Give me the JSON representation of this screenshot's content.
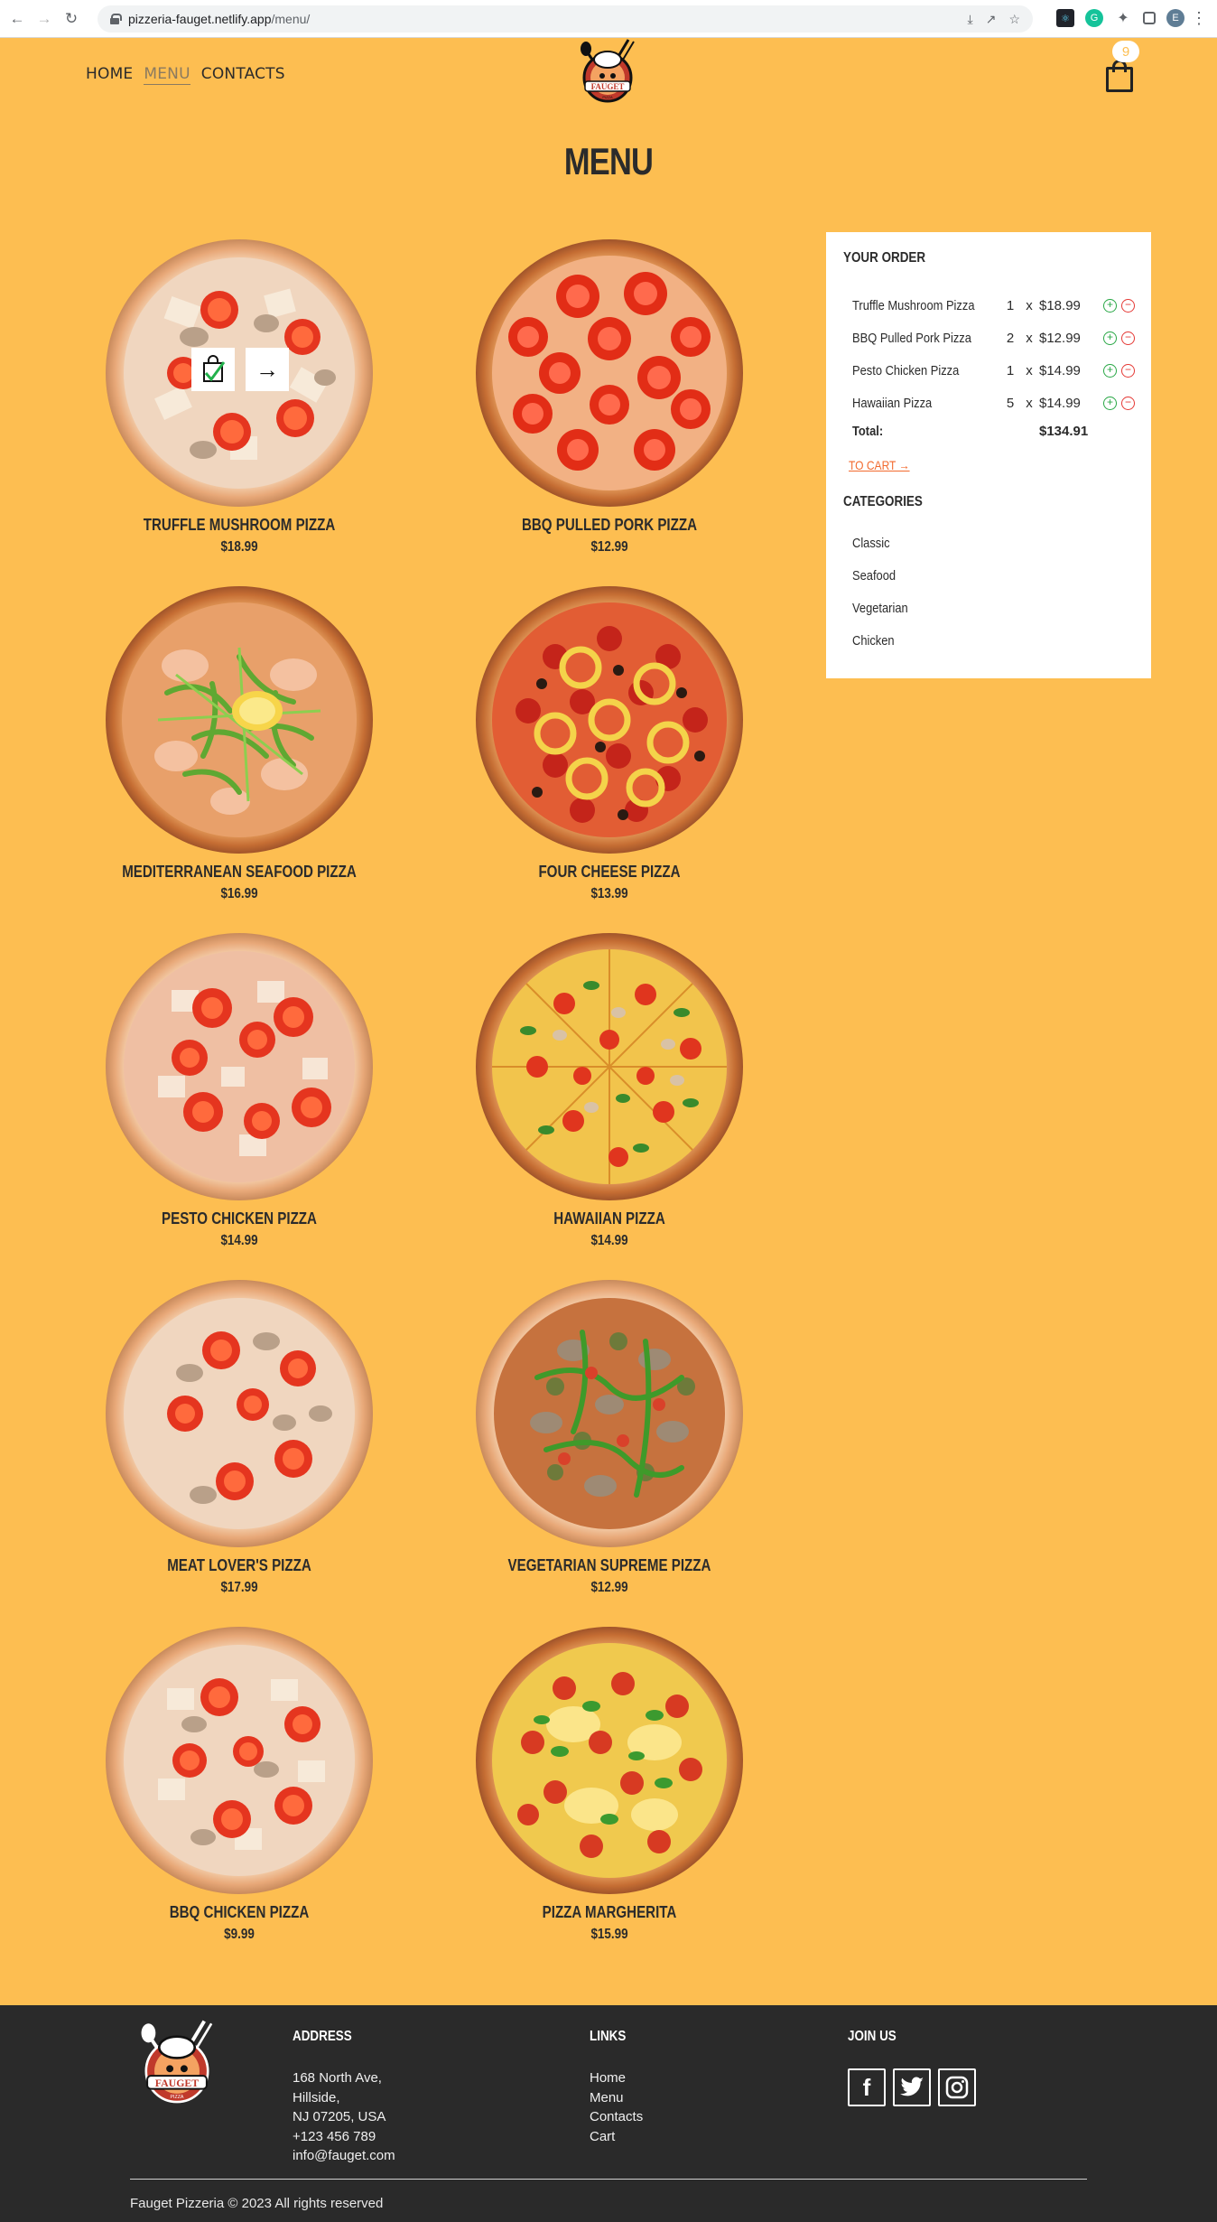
{
  "browser": {
    "url_domain": "pizzeria-fauget.netlify.app",
    "url_path": "/menu/",
    "profile_initial": "E"
  },
  "nav": {
    "items": [
      "HOME",
      "MENU",
      "CONTACTS"
    ],
    "active": "MENU"
  },
  "logo": {
    "text": "FAUGET",
    "sub": "PIZZA"
  },
  "cart": {
    "count": "9"
  },
  "page": {
    "title": "MENU"
  },
  "products": [
    {
      "name": "TRUFFLE MUSHROOM PIZZA",
      "price": "$18.99"
    },
    {
      "name": "BBQ PULLED PORK PIZZA",
      "price": "$12.99"
    },
    {
      "name": "MEDITERRANEAN SEAFOOD PIZZA",
      "price": "$16.99"
    },
    {
      "name": "FOUR CHEESE PIZZA",
      "price": "$13.99"
    },
    {
      "name": "PESTO CHICKEN PIZZA",
      "price": "$14.99"
    },
    {
      "name": "HAWAIIAN PIZZA",
      "price": "$14.99"
    },
    {
      "name": "MEAT LOVER'S PIZZA",
      "price": "$17.99"
    },
    {
      "name": "VEGETARIAN SUPREME PIZZA",
      "price": "$12.99"
    },
    {
      "name": "BBQ CHICKEN PIZZA",
      "price": "$9.99"
    },
    {
      "name": "PIZZA MARGHERITA",
      "price": "$15.99"
    }
  ],
  "order": {
    "heading": "YOUR ORDER",
    "items": [
      {
        "name": "Truffle Mushroom Pizza",
        "qty": "1",
        "x": "x",
        "price": "$18.99"
      },
      {
        "name": "BBQ Pulled Pork Pizza",
        "qty": "2",
        "x": "x",
        "price": "$12.99"
      },
      {
        "name": "Pesto Chicken Pizza",
        "qty": "1",
        "x": "x",
        "price": "$14.99"
      },
      {
        "name": "Hawaiian Pizza",
        "qty": "5",
        "x": "x",
        "price": "$14.99"
      }
    ],
    "total_label": "Total:",
    "total_value": "$134.91",
    "to_cart": "TO CART →"
  },
  "categories": {
    "heading": "CATEGORIES",
    "items": [
      "Classic",
      "Seafood",
      "Vegetarian",
      "Chicken"
    ]
  },
  "footer": {
    "address_heading": "ADDRESS",
    "address_lines": [
      "168 North Ave,",
      "Hillside,",
      "NJ 07205, USA",
      "+123 456 789",
      "info@fauget.com"
    ],
    "links_heading": "LINKS",
    "links": [
      "Home",
      "Menu",
      "Contacts",
      "Cart"
    ],
    "join_heading": "JOIN US",
    "social": [
      "facebook-icon",
      "twitter-icon",
      "instagram-icon"
    ],
    "copyright": "Fauget Pizzeria © 2023 All rights reserved"
  },
  "colors": {
    "background": "#fdbe51",
    "footer": "#2a2a2a",
    "accent": "#f26a2e",
    "plus": "#28a745",
    "minus": "#e53935"
  }
}
